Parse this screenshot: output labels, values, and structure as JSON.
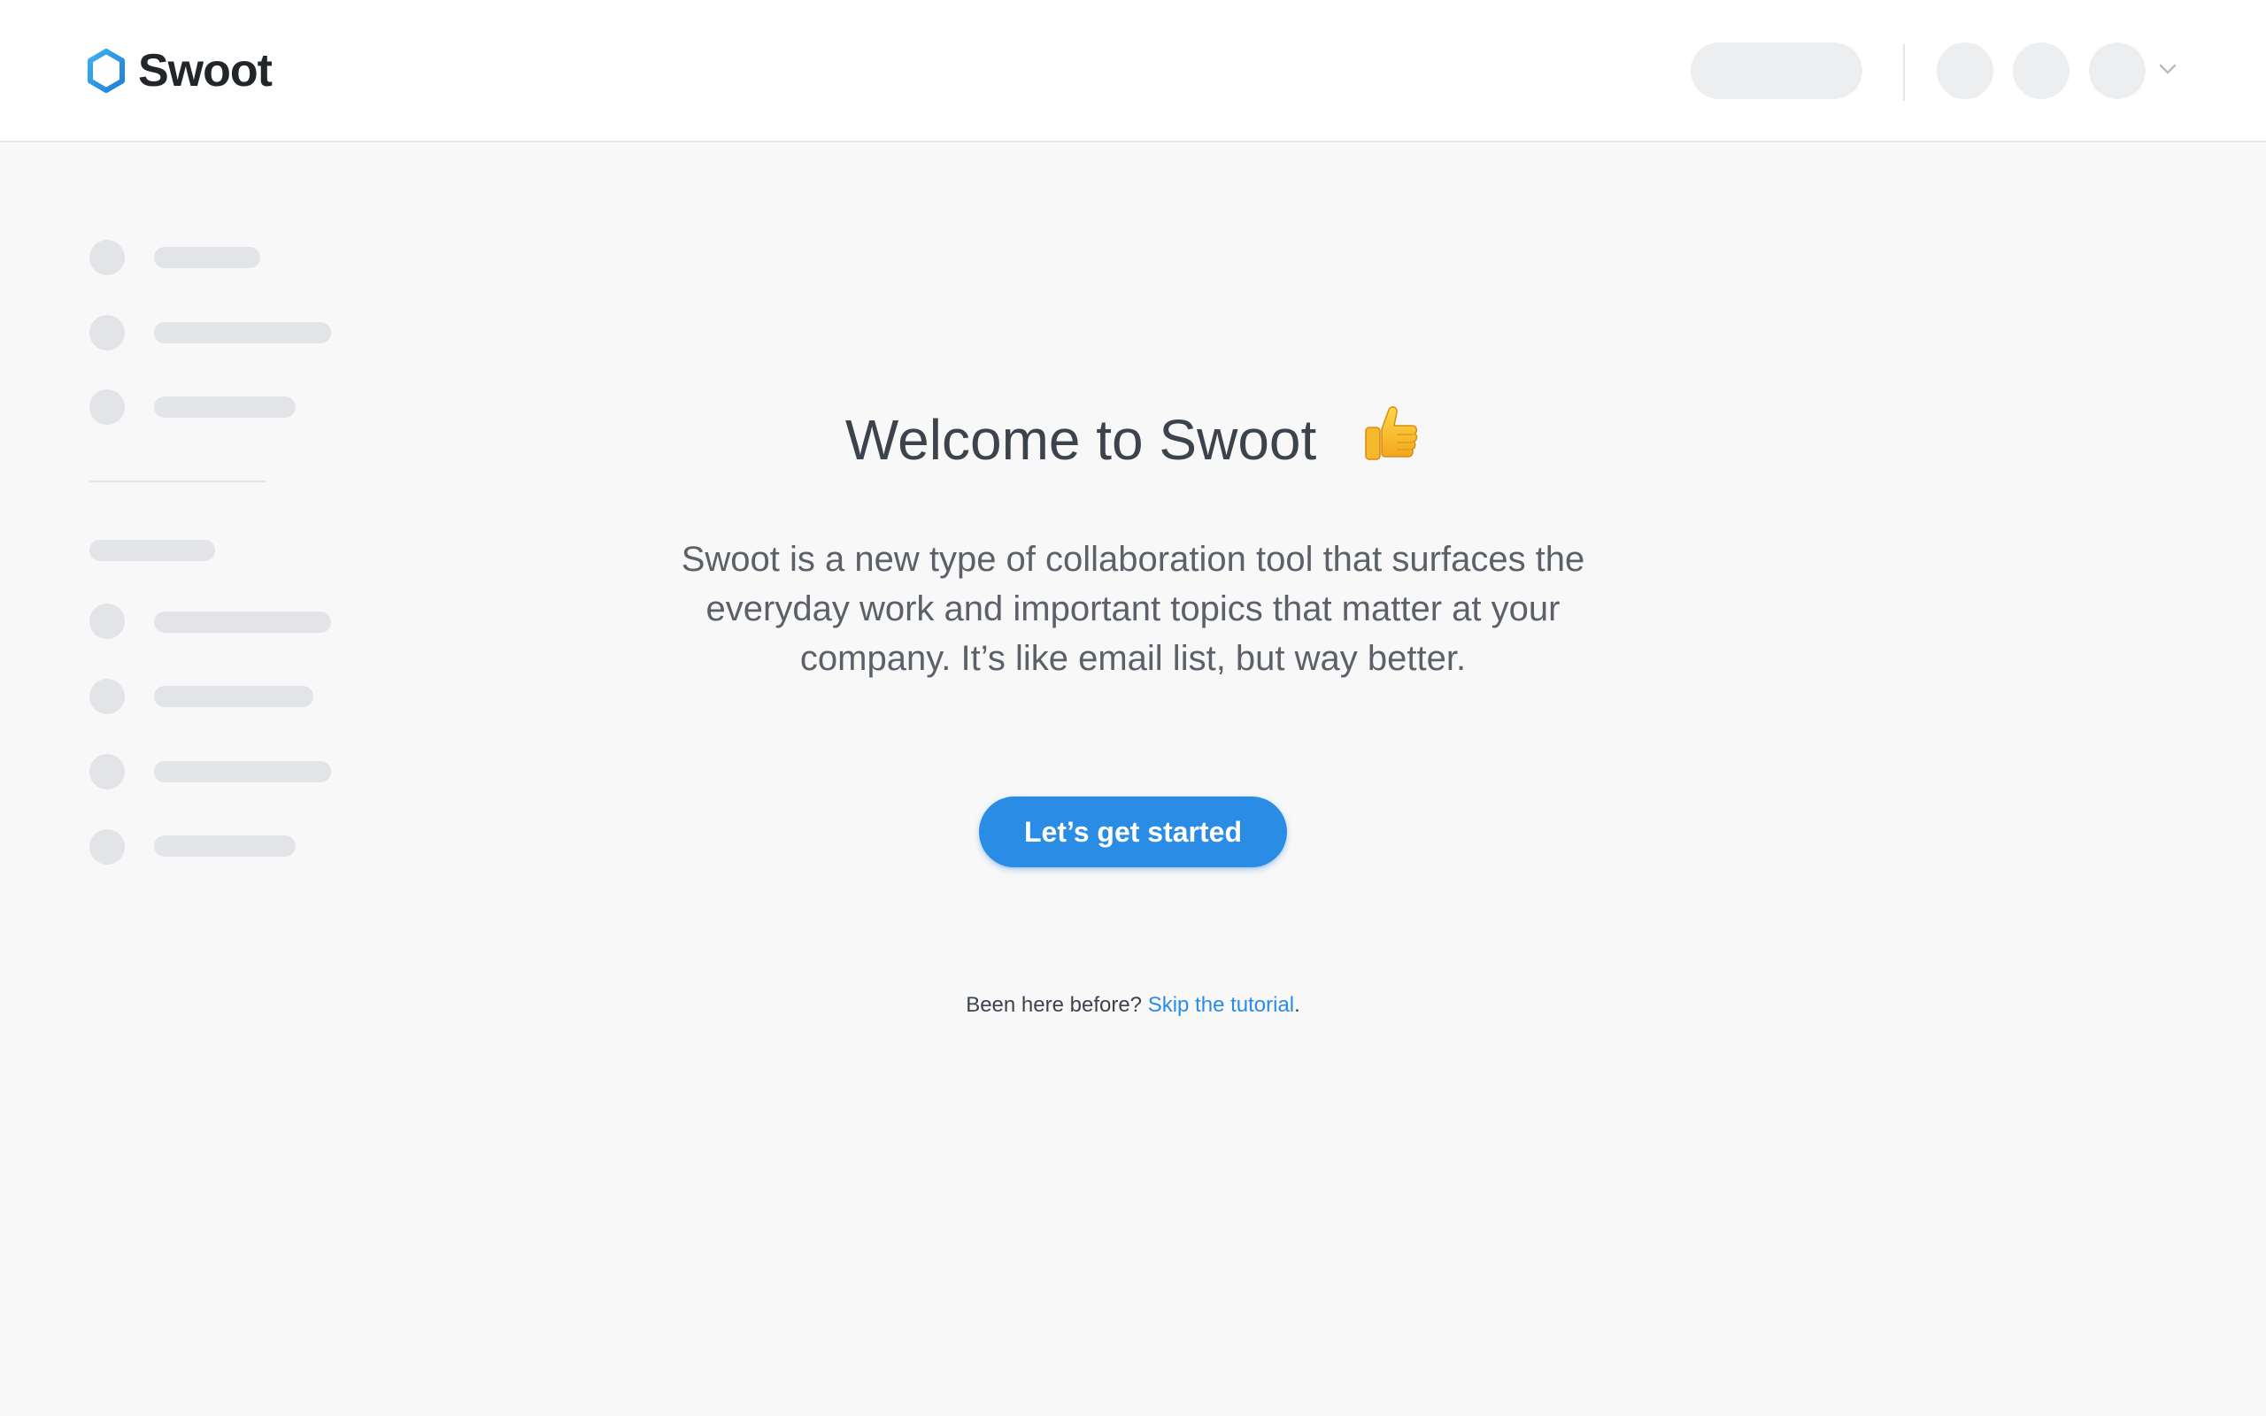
{
  "app": {
    "name": "Swoot",
    "logo_icon": "hexagon-logo-icon",
    "accent_color": "#2b8ce6"
  },
  "header": {
    "placeholder_pill": "",
    "avatars": [
      "",
      "",
      ""
    ],
    "menu_icon": "chevron-down-icon"
  },
  "sidebar": {
    "items_top": [
      "",
      "",
      ""
    ],
    "section_heading": "",
    "items_bottom": [
      "",
      "",
      "",
      ""
    ]
  },
  "welcome": {
    "title": "Welcome to Swoot",
    "title_icon": "thumbs-up-emoji-icon",
    "description": "Swoot is a new type of collaboration tool that surfaces the everyday work and important topics that matter at your company. It’s like email list, but way better.",
    "cta_label": "Let’s get started",
    "skip_prefix": "Been here before?",
    "skip_link_label": "Skip the tutorial",
    "skip_suffix": "."
  }
}
